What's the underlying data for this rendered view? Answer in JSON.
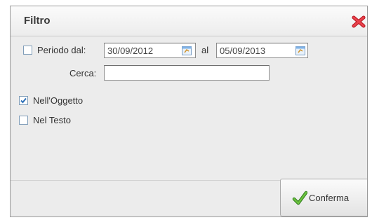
{
  "dialog": {
    "title": "Filtro",
    "close_icon": "close-x-icon"
  },
  "periodo": {
    "checked": false,
    "label": "Periodo dal:",
    "from_value": "30/09/2012",
    "to_label": "al",
    "to_value": "05/09/2013",
    "calendar_icon": "calendar-icon"
  },
  "cerca": {
    "label": "Cerca:",
    "value": ""
  },
  "nell_oggetto": {
    "checked": true,
    "label": "Nell'Oggetto"
  },
  "nel_testo": {
    "checked": false,
    "label": "Nel Testo"
  },
  "footer": {
    "confirm_label": "Conferma",
    "confirm_icon": "check-icon"
  },
  "colors": {
    "dialog_bg": "#ececec",
    "close_red": "#d9232e",
    "check_green": "#4ca12e"
  }
}
